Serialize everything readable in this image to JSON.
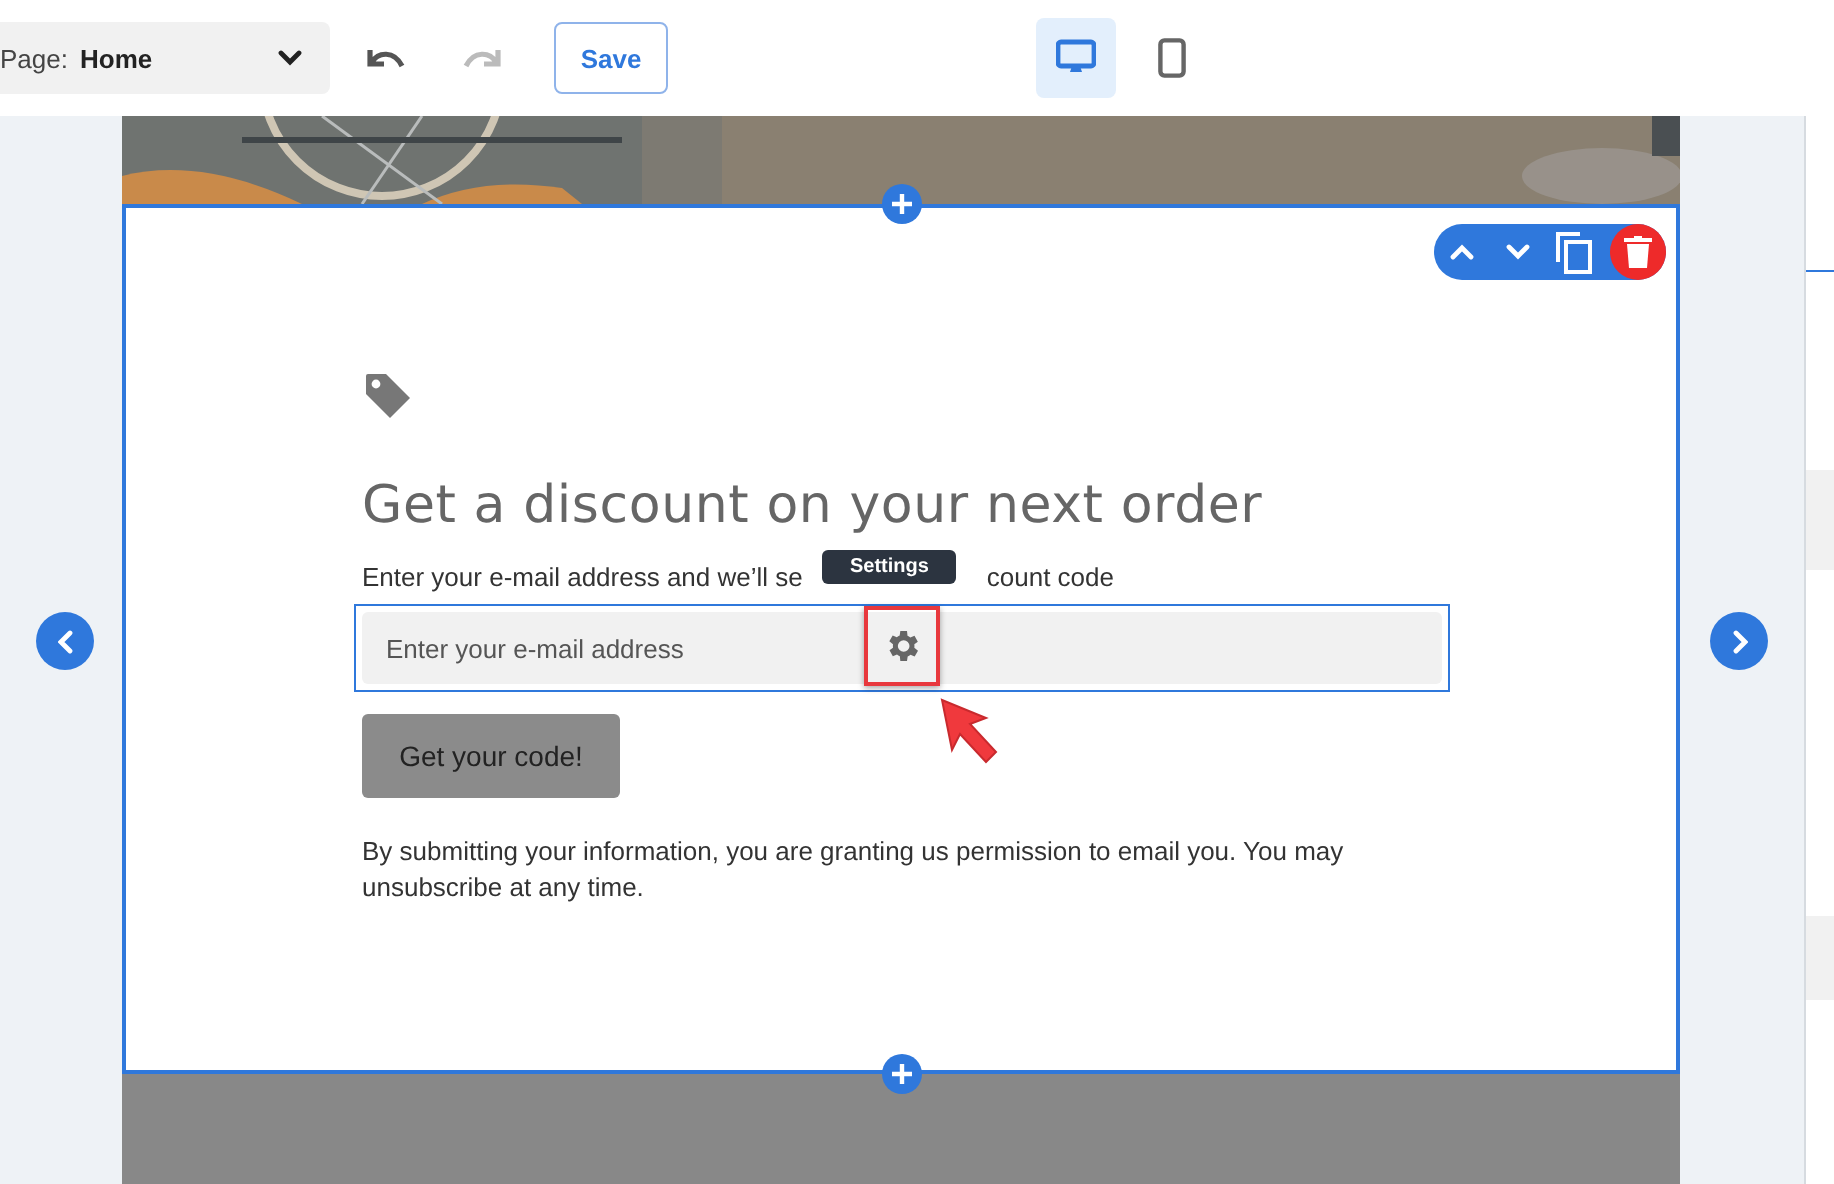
{
  "toolbar": {
    "page_label": "Page:",
    "page_name": "Home",
    "undo": {
      "disabled": false
    },
    "redo": {
      "disabled": true
    },
    "save": "Save",
    "devices": [
      {
        "kind": "desktop",
        "selected": true
      },
      {
        "kind": "mobile",
        "selected": false
      }
    ]
  },
  "section": {
    "heading": "Get a discount on your next order",
    "subtitle_parts": [
      "Enter your e-mail address and we’ll se",
      "count code"
    ],
    "tooltip": "Settings",
    "email_field": {
      "placeholder": "Enter your e-mail address"
    },
    "button": "Get your code!",
    "disclaimer": "By submitting your information, you are granting us permission to email you. You may unsubscribe at any time."
  }
}
